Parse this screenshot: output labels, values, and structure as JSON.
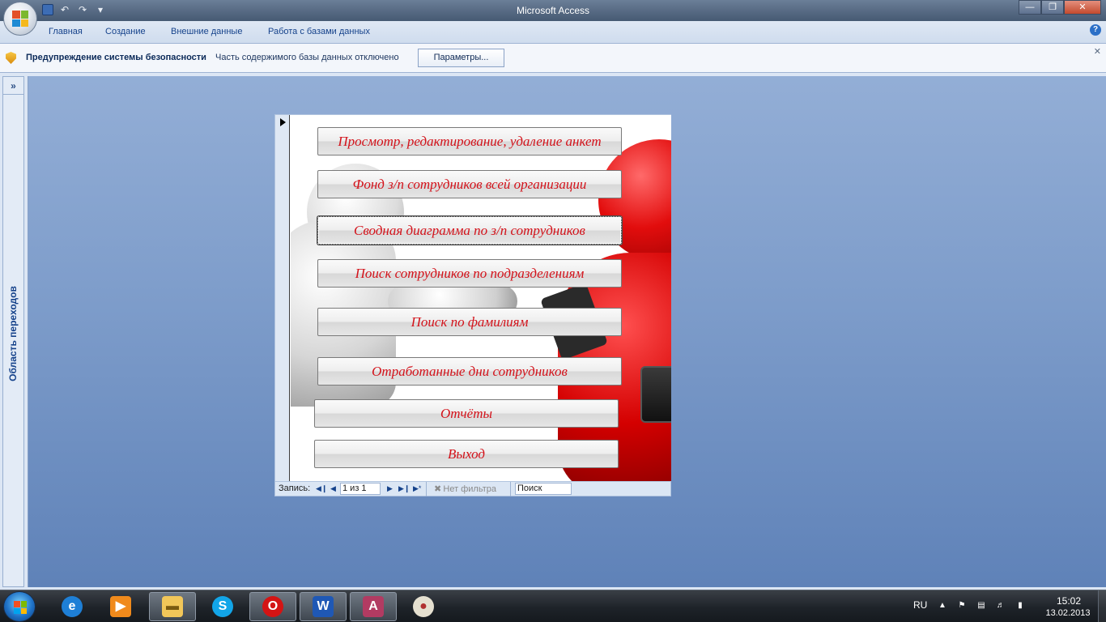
{
  "window": {
    "title": "Microsoft Access"
  },
  "ribbon": {
    "tabs": [
      "Главная",
      "Создание",
      "Внешние данные",
      "Работа с базами данных"
    ]
  },
  "security_bar": {
    "title": "Предупреждение системы безопасности",
    "message": "Часть содержимого базы данных отключено",
    "button": "Параметры..."
  },
  "nav_pane": {
    "label": "Область переходов",
    "toggle": "»"
  },
  "form": {
    "buttons": [
      "Просмотр, редактирование, удаление анкет",
      "Фонд з/п сотрудников всей организации",
      "Сводная диаграмма по з/п сотрудников",
      "Поиск сотрудников по подразделениям",
      "Поиск по фамилиям",
      "Отработанные дни сотрудников",
      "Отчёты",
      "Выход"
    ],
    "record_nav": {
      "label": "Запись:",
      "record": "1 из 1",
      "filter": "Нет фильтра",
      "search_placeholder": "Поиск"
    }
  },
  "taskbar": {
    "language": "RU",
    "time": "15:02",
    "date": "13.02.2013",
    "apps": [
      "internet-explorer",
      "media-player",
      "file-explorer",
      "skype",
      "opera",
      "word",
      "access",
      "paint"
    ]
  },
  "colors": {
    "button_text": "#d3121a",
    "workspace": "#7d9cca",
    "ribbon_text": "#15428b"
  }
}
